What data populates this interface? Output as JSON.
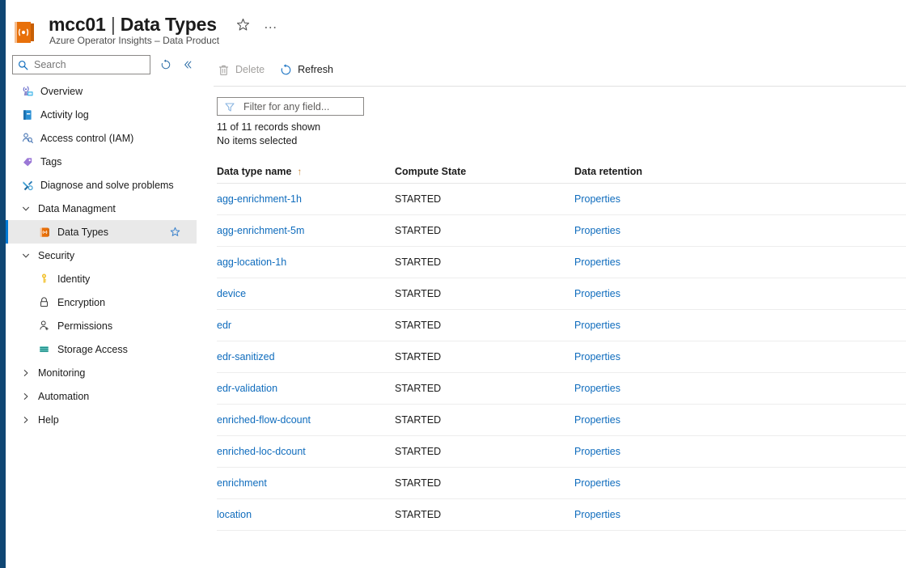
{
  "header": {
    "resource_icon": "data-product-book-icon",
    "title_main": "mcc01",
    "title_sep": " | ",
    "title_page": "Data Types",
    "subtitle": "Azure Operator Insights – Data Product",
    "favorite_icon": "star-outline-icon",
    "more_icon": "ellipsis-icon",
    "more_label": "…"
  },
  "sidebar": {
    "search": {
      "placeholder": "Search",
      "value": "",
      "icon": "search-icon"
    },
    "refresh_icon": "refresh-icon",
    "collapse_icon": "chevron-double-left-icon",
    "items": [
      {
        "label": "Overview",
        "icon": "overview-antenna-icon",
        "type": "item"
      },
      {
        "label": "Activity log",
        "icon": "activity-log-book-icon",
        "type": "item"
      },
      {
        "label": "Access control (IAM)",
        "icon": "access-control-people-icon",
        "type": "item"
      },
      {
        "label": "Tags",
        "icon": "tag-icon",
        "type": "item"
      },
      {
        "label": "Diagnose and solve problems",
        "icon": "wrench-screwdriver-icon",
        "type": "item"
      },
      {
        "label": "Data Managment",
        "icon": "chevron-down-icon",
        "type": "group",
        "expanded": true
      },
      {
        "label": "Data Types",
        "icon": "data-types-book-icon",
        "type": "child",
        "selected": true,
        "favorite_icon": "star-outline-icon"
      },
      {
        "label": "Security",
        "icon": "chevron-down-icon",
        "type": "group",
        "expanded": true
      },
      {
        "label": "Identity",
        "icon": "key-icon",
        "type": "child"
      },
      {
        "label": "Encryption",
        "icon": "lock-icon",
        "type": "child"
      },
      {
        "label": "Permissions",
        "icon": "person-add-icon",
        "type": "child"
      },
      {
        "label": "Storage Access",
        "icon": "storage-icon",
        "type": "child"
      },
      {
        "label": "Monitoring",
        "icon": "chevron-right-icon",
        "type": "group",
        "expanded": false
      },
      {
        "label": "Automation",
        "icon": "chevron-right-icon",
        "type": "group",
        "expanded": false
      },
      {
        "label": "Help",
        "icon": "chevron-right-icon",
        "type": "group",
        "expanded": false
      }
    ]
  },
  "toolbar": {
    "delete_label": "Delete",
    "delete_icon": "trash-icon",
    "delete_disabled": true,
    "refresh_label": "Refresh",
    "refresh_icon": "refresh-circle-icon"
  },
  "filter": {
    "placeholder": "Filter for any field...",
    "value": "",
    "icon": "funnel-icon",
    "records_text": "11 of 11 records shown",
    "selection_text": "No items selected"
  },
  "table": {
    "columns": [
      {
        "label": "Data type name",
        "sort": "asc",
        "sort_glyph": "↑"
      },
      {
        "label": "Compute State",
        "sort": "none"
      },
      {
        "label": "Data retention",
        "sort": "none"
      }
    ],
    "rows": [
      {
        "name": "agg-enrichment-1h",
        "state": "STARTED",
        "retention": "Properties"
      },
      {
        "name": "agg-enrichment-5m",
        "state": "STARTED",
        "retention": "Properties"
      },
      {
        "name": "agg-location-1h",
        "state": "STARTED",
        "retention": "Properties"
      },
      {
        "name": "device",
        "state": "STARTED",
        "retention": "Properties"
      },
      {
        "name": "edr",
        "state": "STARTED",
        "retention": "Properties"
      },
      {
        "name": "edr-sanitized",
        "state": "STARTED",
        "retention": "Properties"
      },
      {
        "name": "edr-validation",
        "state": "STARTED",
        "retention": "Properties"
      },
      {
        "name": "enriched-flow-dcount",
        "state": "STARTED",
        "retention": "Properties"
      },
      {
        "name": "enriched-loc-dcount",
        "state": "STARTED",
        "retention": "Properties"
      },
      {
        "name": "enrichment",
        "state": "STARTED",
        "retention": "Properties"
      },
      {
        "name": "location",
        "state": "STARTED",
        "retention": "Properties"
      }
    ]
  },
  "colors": {
    "accent": "#0078d4",
    "link": "#0f6cbd",
    "rail": "#0f4673",
    "resource_orange": "#e8700a",
    "selected_bg": "#e9e9e9",
    "sort_arrow": "#c98a3b"
  }
}
